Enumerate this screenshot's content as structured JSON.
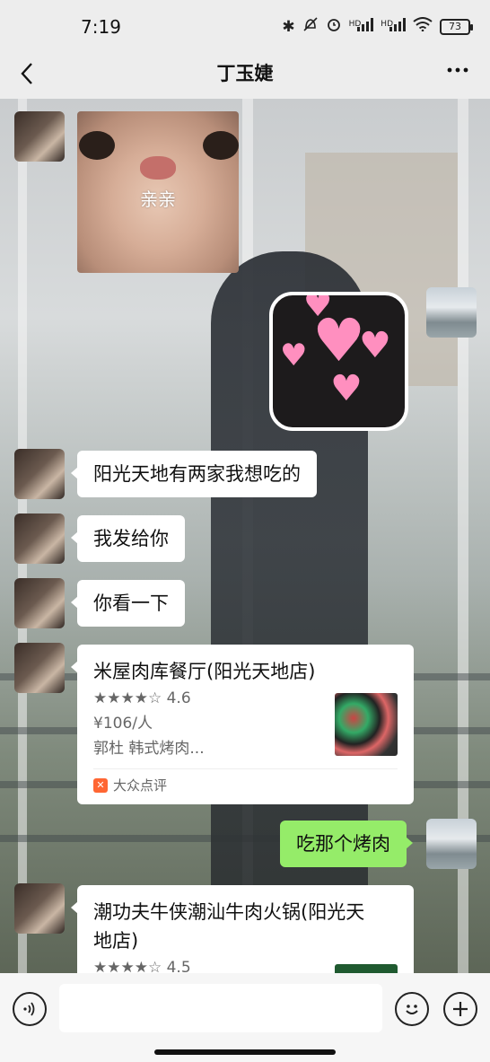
{
  "status_bar": {
    "time": "7:19",
    "battery": "73",
    "icons": [
      "bluetooth-icon",
      "mute-icon",
      "alarm-icon",
      "hd-signal-icon",
      "hd-signal-icon",
      "wifi-icon",
      "battery-icon"
    ]
  },
  "header": {
    "title": "丁玉婕",
    "back_icon": "chevron-left-icon",
    "more_icon": "more-icon"
  },
  "messages": {
    "sticker_cat_text": "亲亲",
    "m1": "阳光天地有两家我想吃的",
    "m2": "我发给你",
    "m3": "你看一下",
    "card1": {
      "title": "米屋肉库餐厅(阳光天地店)",
      "rating": "★★★★☆ 4.6",
      "price": "¥106/人",
      "tags": "郭杜 韩式烤肉...",
      "source": "大众点评"
    },
    "self_reply": "吃那个烤肉",
    "card2": {
      "title_line1": "潮功夫牛侠潮汕牛肉火锅(阳光天",
      "title_line2": "地店)",
      "rating": "★★★★☆ 4.5"
    }
  },
  "input_bar": {
    "placeholder": ""
  },
  "colors": {
    "self_bubble": "#95ec69",
    "other_bubble": "#ffffff",
    "chrome_bg": "#ededed",
    "source_logo": "#ff6633"
  }
}
